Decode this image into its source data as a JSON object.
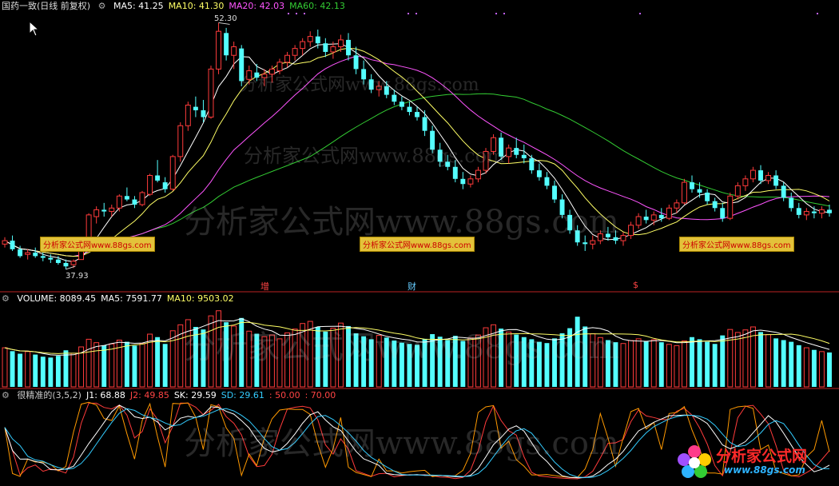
{
  "price_panel": {
    "stock_name": "国药一致(日线 前复权)",
    "indicators": [
      {
        "label": "MA5: 41.25",
        "color": "#ffffff"
      },
      {
        "label": "MA10: 41.30",
        "color": "#ffff66"
      },
      {
        "label": "MA20: 42.03",
        "color": "#ff55ff"
      },
      {
        "label": "MA60: 42.13",
        "color": "#33cc33"
      }
    ],
    "high_label": "52.30",
    "low_label": "37.93",
    "tags": [
      "分析家公式网www.88gs.com",
      "分析家公式网www.88gs.com",
      "分析家公式网www.88gs.com"
    ],
    "events": [
      "增",
      "财",
      "$"
    ]
  },
  "volume_panel": {
    "indicators": [
      {
        "label": "VOLUME: 8089.45",
        "color": "#ffffff"
      },
      {
        "label": "MA5: 7591.77",
        "color": "#ffffff"
      },
      {
        "label": "MA10: 9503.02",
        "color": "#ffff66"
      }
    ]
  },
  "osc_panel": {
    "indicators": [
      {
        "label": "很精准的(3,5,2)",
        "color": "#cccccc"
      },
      {
        "label": "J1: 68.88",
        "color": "#ffffff"
      },
      {
        "label": "J2: 49.85",
        "color": "#ff4444"
      },
      {
        "label": "SK: 29.59",
        "color": "#ffffff"
      },
      {
        "label": "SD: 29.61",
        "color": "#33ccff"
      },
      {
        "label": ": 50.00",
        "color": "#ff4444"
      },
      {
        "label": ": 70.00",
        "color": "#ff4444"
      }
    ]
  },
  "watermarks": [
    "分析家公式网www.88gs.com",
    "分析家公式网www.88gs.com",
    "分析家公式网www.88gs.com",
    "分析家公式网www.88gs.com",
    "分析家公式网www.88gs.com"
  ],
  "logo": {
    "title": "分析家公式网",
    "url": "www.88gs.com"
  },
  "chart_data": {
    "type": "candlestick",
    "price_range": [
      37.93,
      52.3
    ],
    "colors": {
      "up": "#ff3b3b",
      "down": "#54ffff",
      "ma5": "#ffffff",
      "ma10": "#ffff66",
      "ma20": "#ff55ff",
      "ma60": "#33cc33"
    },
    "candles": [
      [
        39.4,
        39.8,
        39.2,
        39.6
      ],
      [
        39.6,
        39.9,
        39.0,
        39.1
      ],
      [
        39.1,
        39.3,
        38.6,
        38.7
      ],
      [
        38.8,
        39.1,
        38.5,
        38.9
      ],
      [
        38.9,
        39.2,
        38.6,
        38.7
      ],
      [
        38.7,
        38.9,
        38.4,
        38.6
      ],
      [
        38.6,
        38.8,
        38.3,
        38.5
      ],
      [
        38.5,
        38.7,
        38.2,
        38.3
      ],
      [
        38.3,
        38.5,
        37.93,
        38.1
      ],
      [
        38.2,
        38.5,
        38.0,
        38.4
      ],
      [
        38.5,
        39.8,
        38.5,
        39.7
      ],
      [
        39.7,
        41.2,
        39.6,
        41.1
      ],
      [
        41.0,
        41.6,
        40.6,
        41.4
      ],
      [
        41.4,
        41.8,
        41.0,
        41.3
      ],
      [
        41.3,
        41.7,
        41.0,
        41.5
      ],
      [
        41.5,
        42.3,
        41.3,
        42.2
      ],
      [
        42.2,
        42.7,
        41.9,
        42.0
      ],
      [
        42.0,
        42.2,
        41.5,
        41.7
      ],
      [
        41.7,
        42.5,
        41.6,
        42.4
      ],
      [
        42.3,
        43.5,
        42.2,
        43.4
      ],
      [
        43.4,
        44.3,
        43.0,
        43.1
      ],
      [
        43.0,
        43.3,
        42.4,
        42.6
      ],
      [
        42.6,
        44.6,
        42.5,
        44.5
      ],
      [
        44.5,
        46.5,
        44.2,
        46.3
      ],
      [
        46.3,
        47.7,
        46.0,
        47.5
      ],
      [
        47.4,
        48.0,
        46.8,
        47.2
      ],
      [
        47.2,
        47.8,
        46.5,
        46.8
      ],
      [
        46.8,
        49.8,
        46.7,
        49.6
      ],
      [
        49.6,
        52.3,
        49.3,
        51.8
      ],
      [
        51.7,
        52.0,
        50.1,
        50.4
      ],
      [
        50.4,
        51.2,
        49.6,
        50.9
      ],
      [
        50.8,
        51.0,
        48.6,
        48.9
      ],
      [
        49.0,
        49.8,
        48.7,
        49.5
      ],
      [
        49.4,
        49.9,
        48.9,
        49.1
      ],
      [
        49.1,
        49.6,
        48.6,
        49.3
      ],
      [
        49.3,
        49.8,
        48.8,
        49.6
      ],
      [
        49.5,
        50.2,
        49.3,
        50.0
      ],
      [
        50.0,
        50.6,
        49.7,
        50.4
      ],
      [
        50.4,
        51.0,
        50.1,
        50.8
      ],
      [
        50.8,
        51.4,
        50.4,
        51.2
      ],
      [
        51.2,
        51.8,
        50.9,
        51.5
      ],
      [
        51.5,
        51.9,
        50.8,
        51.1
      ],
      [
        51.1,
        51.4,
        50.3,
        50.6
      ],
      [
        50.6,
        51.2,
        50.2,
        50.9
      ],
      [
        50.9,
        51.6,
        50.6,
        51.3
      ],
      [
        51.3,
        51.7,
        50.1,
        50.4
      ],
      [
        50.4,
        50.9,
        49.3,
        49.6
      ],
      [
        49.6,
        50.1,
        48.7,
        49.0
      ],
      [
        49.0,
        49.3,
        48.2,
        48.4
      ],
      [
        48.4,
        48.9,
        48.0,
        48.6
      ],
      [
        48.6,
        48.9,
        47.9,
        48.1
      ],
      [
        48.1,
        48.4,
        47.5,
        47.7
      ],
      [
        47.7,
        48.0,
        47.2,
        47.4
      ],
      [
        47.4,
        47.7,
        46.9,
        47.1
      ],
      [
        47.1,
        47.4,
        46.6,
        46.8
      ],
      [
        46.8,
        47.2,
        45.7,
        46.0
      ],
      [
        46.0,
        46.3,
        44.7,
        44.9
      ],
      [
        44.9,
        45.3,
        43.9,
        44.2
      ],
      [
        44.2,
        44.6,
        43.7,
        43.9
      ],
      [
        43.9,
        44.3,
        43.0,
        43.2
      ],
      [
        43.2,
        43.6,
        42.6,
        42.9
      ],
      [
        42.9,
        43.4,
        42.7,
        43.2
      ],
      [
        43.2,
        43.9,
        43.0,
        43.7
      ],
      [
        43.7,
        45.0,
        43.5,
        44.8
      ],
      [
        44.8,
        45.8,
        44.6,
        45.6
      ],
      [
        45.6,
        45.9,
        44.3,
        44.5
      ],
      [
        44.5,
        45.2,
        44.1,
        45.0
      ],
      [
        45.0,
        45.6,
        44.4,
        44.6
      ],
      [
        44.6,
        45.2,
        44.1,
        44.4
      ],
      [
        44.4,
        44.6,
        43.5,
        43.7
      ],
      [
        43.7,
        44.1,
        43.1,
        43.3
      ],
      [
        43.3,
        43.6,
        42.6,
        42.8
      ],
      [
        42.8,
        43.1,
        41.8,
        42.0
      ],
      [
        42.0,
        42.3,
        40.9,
        41.1
      ],
      [
        41.1,
        41.4,
        40.0,
        40.2
      ],
      [
        40.2,
        40.5,
        39.3,
        39.5
      ],
      [
        39.5,
        39.9,
        39.0,
        39.4
      ],
      [
        39.4,
        39.9,
        39.1,
        39.6
      ],
      [
        39.6,
        40.2,
        39.4,
        40.0
      ],
      [
        40.0,
        40.4,
        39.6,
        39.8
      ],
      [
        39.8,
        40.2,
        39.4,
        39.6
      ],
      [
        39.6,
        40.1,
        39.3,
        39.9
      ],
      [
        39.9,
        40.7,
        39.7,
        40.5
      ],
      [
        40.5,
        41.2,
        40.3,
        41.0
      ],
      [
        41.0,
        41.4,
        40.6,
        40.8
      ],
      [
        40.8,
        41.3,
        40.5,
        41.1
      ],
      [
        41.1,
        41.5,
        40.7,
        40.9
      ],
      [
        40.9,
        41.7,
        40.8,
        41.5
      ],
      [
        41.5,
        42.0,
        41.2,
        41.8
      ],
      [
        41.8,
        43.2,
        41.7,
        43.0
      ],
      [
        43.0,
        43.4,
        42.4,
        42.6
      ],
      [
        42.6,
        43.0,
        42.1,
        42.4
      ],
      [
        42.4,
        42.6,
        41.7,
        41.9
      ],
      [
        41.9,
        42.1,
        41.3,
        41.5
      ],
      [
        41.5,
        41.8,
        40.7,
        40.9
      ],
      [
        40.9,
        42.4,
        40.8,
        42.2
      ],
      [
        42.2,
        43.0,
        42.0,
        42.8
      ],
      [
        42.8,
        43.4,
        42.5,
        43.2
      ],
      [
        43.2,
        43.9,
        43.0,
        43.7
      ],
      [
        43.7,
        44.0,
        42.9,
        43.1
      ],
      [
        43.1,
        43.6,
        42.9,
        43.4
      ],
      [
        43.4,
        43.7,
        42.6,
        42.8
      ],
      [
        42.8,
        43.0,
        41.9,
        42.1
      ],
      [
        42.1,
        42.4,
        41.3,
        41.5
      ],
      [
        41.5,
        41.8,
        40.9,
        41.1
      ],
      [
        41.1,
        41.5,
        40.8,
        41.3
      ],
      [
        41.3,
        41.6,
        40.9,
        41.2
      ],
      [
        41.2,
        41.6,
        40.9,
        41.4
      ],
      [
        41.4,
        41.7,
        41.0,
        41.2
      ]
    ],
    "volume": [
      9200,
      8400,
      7800,
      8300,
      7600,
      7100,
      6900,
      7300,
      8600,
      7900,
      9400,
      11200,
      10400,
      9800,
      10100,
      11000,
      10600,
      9700,
      10200,
      12400,
      11700,
      10100,
      13200,
      14600,
      15800,
      14100,
      13500,
      16700,
      17900,
      15200,
      14300,
      16200,
      13100,
      12500,
      11800,
      12200,
      11300,
      12700,
      13600,
      14900,
      15400,
      14100,
      13000,
      13800,
      15000,
      14300,
      12600,
      11900,
      11200,
      12100,
      11600,
      10900,
      10400,
      10100,
      9900,
      11300,
      12400,
      11800,
      11000,
      12000,
      10800,
      11500,
      12200,
      13900,
      14600,
      13700,
      12900,
      12300,
      11700,
      11200,
      10600,
      10300,
      11400,
      12600,
      13800,
      16500,
      14200,
      12500,
      11600,
      11000,
      10500,
      10200,
      10900,
      11300,
      10700,
      11100,
      10500,
      10000,
      9700,
      10800,
      11700,
      11200,
      10600,
      10100,
      12100,
      13500,
      12800,
      13400,
      14100,
      12900,
      12300,
      11400,
      11000,
      10600,
      9800,
      9200,
      8700,
      8300,
      8089.45
    ],
    "volume_ma5": 7591.77,
    "volume_ma10": 9503.02,
    "oscillator": {
      "name": "很精准的(3,5,2)",
      "J1": 68.88,
      "J2": 49.85,
      "SK": 29.59,
      "SD": 29.61,
      "levels": [
        50.0,
        70.0
      ]
    }
  }
}
